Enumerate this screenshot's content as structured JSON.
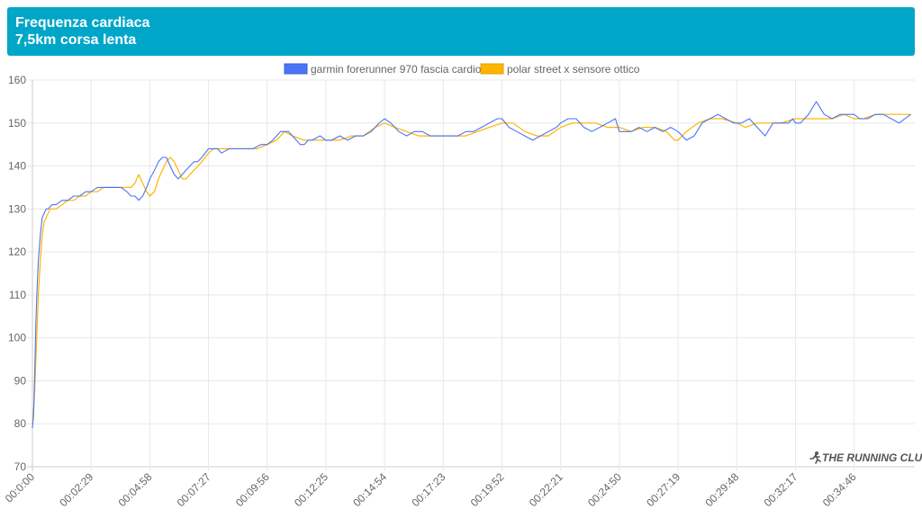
{
  "header": {
    "title_line1": "Frequenza cardiaca",
    "title_line2": "7,5km corsa lenta"
  },
  "watermark": "THE RUNNING CLUB",
  "colors": {
    "header_bg": "#00a6c8",
    "garmin": "#4a74f5",
    "polar": "#ffb400",
    "grid": "#e8e8e8"
  },
  "chart_data": {
    "type": "line",
    "ylim": [
      70,
      160
    ],
    "yticks": [
      70,
      80,
      90,
      100,
      110,
      120,
      130,
      140,
      150,
      160
    ],
    "xlim_seconds": [
      0,
      2240
    ],
    "xticks": [
      "00:0:00",
      "00:02:29",
      "00:04:58",
      "00:07:27",
      "00:09:56",
      "00:12:25",
      "00:14:54",
      "00:17:23",
      "00:19:52",
      "00:22:21",
      "00:24:50",
      "00:27:19",
      "00:29:48",
      "00:32:17",
      "00:34:46"
    ],
    "legend_position": "top",
    "series": [
      {
        "name": "garmin forerunner 970 fascia cardio",
        "color": "#4a74f5",
        "t": [
          "00:0:00",
          "00:00:03",
          "00:00:06",
          "00:00:09",
          "00:00:12",
          "00:00:15",
          "00:00:20",
          "00:00:25",
          "00:00:30",
          "00:00:35",
          "00:00:40",
          "00:00:50",
          "00:01:00",
          "00:01:15",
          "00:01:30",
          "00:01:45",
          "00:02:00",
          "00:02:15",
          "00:02:29",
          "00:02:45",
          "00:03:00",
          "00:03:15",
          "00:03:30",
          "00:03:45",
          "00:04:00",
          "00:04:10",
          "00:04:20",
          "00:04:30",
          "00:04:40",
          "00:04:50",
          "00:04:58",
          "00:05:10",
          "00:05:20",
          "00:05:30",
          "00:05:40",
          "00:05:50",
          "00:06:00",
          "00:06:10",
          "00:06:20",
          "00:06:30",
          "00:06:40",
          "00:06:50",
          "00:07:00",
          "00:07:10",
          "00:07:27",
          "00:07:40",
          "00:07:50",
          "00:08:00",
          "00:08:20",
          "00:08:40",
          "00:09:00",
          "00:09:20",
          "00:09:40",
          "00:09:56",
          "00:10:10",
          "00:10:30",
          "00:10:50",
          "00:11:00",
          "00:11:10",
          "00:11:20",
          "00:11:30",
          "00:11:40",
          "00:11:50",
          "00:12:10",
          "00:12:25",
          "00:12:40",
          "00:13:00",
          "00:13:20",
          "00:13:40",
          "00:14:00",
          "00:14:20",
          "00:14:40",
          "00:14:54",
          "00:15:10",
          "00:15:30",
          "00:15:50",
          "00:16:10",
          "00:16:30",
          "00:16:50",
          "00:17:10",
          "00:17:23",
          "00:17:40",
          "00:18:00",
          "00:18:20",
          "00:18:40",
          "00:19:00",
          "00:19:20",
          "00:19:40",
          "00:19:52",
          "00:20:10",
          "00:20:30",
          "00:20:50",
          "00:21:10",
          "00:21:30",
          "00:21:50",
          "00:22:10",
          "00:22:21",
          "00:22:40",
          "00:23:00",
          "00:23:20",
          "00:23:40",
          "00:24:00",
          "00:24:20",
          "00:24:40",
          "00:24:50",
          "00:25:05",
          "00:25:20",
          "00:25:40",
          "00:26:00",
          "00:26:20",
          "00:26:40",
          "00:27:00",
          "00:27:19",
          "00:27:40",
          "00:28:00",
          "00:28:20",
          "00:28:40",
          "00:29:00",
          "00:29:20",
          "00:29:40",
          "00:29:48",
          "00:30:00",
          "00:30:20",
          "00:30:40",
          "00:31:00",
          "00:31:20",
          "00:31:40",
          "00:32:00",
          "00:32:10",
          "00:32:17",
          "00:32:30",
          "00:32:50",
          "00:33:10",
          "00:33:30",
          "00:33:50",
          "00:34:10",
          "00:34:30",
          "00:34:46",
          "00:35:00",
          "00:35:20",
          "00:35:40",
          "00:36:00",
          "00:36:20",
          "00:36:40",
          "00:37:10"
        ],
        "v": [
          79,
          82,
          92,
          104,
          112,
          118,
          124,
          128,
          129,
          130,
          130,
          131,
          131,
          132,
          132,
          133,
          133,
          134,
          134,
          135,
          135,
          135,
          135,
          135,
          134,
          133,
          133,
          132,
          133,
          135,
          137,
          139,
          141,
          142,
          142,
          140,
          138,
          137,
          138,
          139,
          140,
          141,
          141,
          142,
          144,
          144,
          144,
          143,
          144,
          144,
          144,
          144,
          145,
          145,
          146,
          148,
          148,
          147,
          146,
          145,
          145,
          146,
          146,
          147,
          146,
          146,
          147,
          146,
          147,
          147,
          148,
          150,
          151,
          150,
          148,
          147,
          148,
          148,
          147,
          147,
          147,
          147,
          147,
          148,
          148,
          149,
          150,
          151,
          151,
          149,
          148,
          147,
          146,
          147,
          148,
          149,
          150,
          151,
          151,
          149,
          148,
          149,
          150,
          151,
          148,
          148,
          148,
          149,
          148,
          149,
          148,
          149,
          148,
          146,
          147,
          150,
          151,
          152,
          151,
          150,
          150,
          150,
          151,
          149,
          147,
          150,
          150,
          150,
          151,
          150,
          150,
          152,
          155,
          152,
          151,
          152,
          152,
          152,
          151,
          151,
          152,
          152,
          151,
          150,
          152,
          153,
          153,
          152,
          152
        ]
      },
      {
        "name": "polar street x sensore ottico",
        "color": "#ffb400",
        "t": [
          "00:0:00",
          "00:00:05",
          "00:00:10",
          "00:00:15",
          "00:00:20",
          "00:00:25",
          "00:00:30",
          "00:00:35",
          "00:00:45",
          "00:01:00",
          "00:01:15",
          "00:01:30",
          "00:01:45",
          "00:02:00",
          "00:02:15",
          "00:02:29",
          "00:02:45",
          "00:03:00",
          "00:03:20",
          "00:03:40",
          "00:04:00",
          "00:04:10",
          "00:04:20",
          "00:04:30",
          "00:04:40",
          "00:04:50",
          "00:04:58",
          "00:05:10",
          "00:05:20",
          "00:05:30",
          "00:05:40",
          "00:05:50",
          "00:06:00",
          "00:06:10",
          "00:06:20",
          "00:06:30",
          "00:06:40",
          "00:06:50",
          "00:07:00",
          "00:07:10",
          "00:07:27",
          "00:07:40",
          "00:08:00",
          "00:08:30",
          "00:09:00",
          "00:09:30",
          "00:09:56",
          "00:10:20",
          "00:10:40",
          "00:11:00",
          "00:11:30",
          "00:12:00",
          "00:12:25",
          "00:13:00",
          "00:13:30",
          "00:14:00",
          "00:14:30",
          "00:14:54",
          "00:15:20",
          "00:15:50",
          "00:16:20",
          "00:16:50",
          "00:17:23",
          "00:17:50",
          "00:18:20",
          "00:18:50",
          "00:19:20",
          "00:19:52",
          "00:20:20",
          "00:20:50",
          "00:21:20",
          "00:21:50",
          "00:22:21",
          "00:22:50",
          "00:23:20",
          "00:23:50",
          "00:24:20",
          "00:24:50",
          "00:25:20",
          "00:25:50",
          "00:26:20",
          "00:26:50",
          "00:27:10",
          "00:27:19",
          "00:27:40",
          "00:28:10",
          "00:28:40",
          "00:29:10",
          "00:29:48",
          "00:30:10",
          "00:30:40",
          "00:31:10",
          "00:31:40",
          "00:32:17",
          "00:32:50",
          "00:33:20",
          "00:33:50",
          "00:34:20",
          "00:34:46",
          "00:35:10",
          "00:35:40",
          "00:36:10",
          "00:36:40",
          "00:37:10"
        ],
        "v": [
          80,
          86,
          98,
          110,
          118,
          124,
          127,
          128,
          130,
          130,
          131,
          132,
          132,
          133,
          133,
          134,
          134,
          135,
          135,
          135,
          135,
          135,
          136,
          138,
          136,
          134,
          133,
          134,
          137,
          139,
          141,
          142,
          141,
          139,
          137,
          137,
          138,
          139,
          140,
          141,
          143,
          144,
          144,
          144,
          144,
          144,
          145,
          146,
          148,
          147,
          146,
          146,
          146,
          146,
          147,
          147,
          149,
          150,
          149,
          148,
          147,
          147,
          147,
          147,
          147,
          148,
          149,
          150,
          150,
          148,
          147,
          147,
          149,
          150,
          150,
          150,
          149,
          149,
          148,
          149,
          149,
          148,
          146,
          146,
          148,
          150,
          151,
          151,
          150,
          149,
          150,
          150,
          150,
          151,
          151,
          151,
          151,
          152,
          151,
          151,
          152,
          152,
          152,
          152
        ]
      }
    ]
  }
}
